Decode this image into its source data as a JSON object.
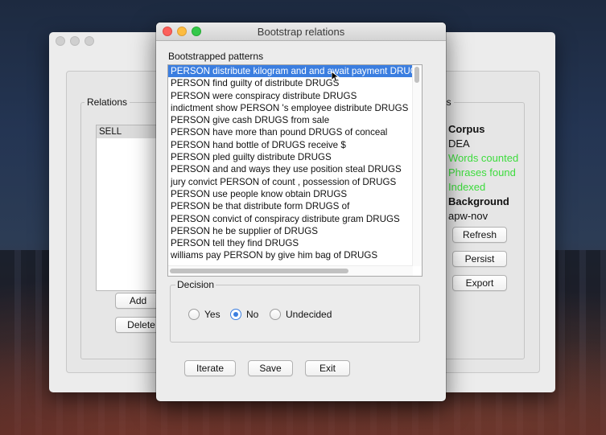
{
  "main_window": {
    "relations_title": "Relations",
    "relations_items": [
      "SELL"
    ],
    "add_label": "Add",
    "delete_label": "Delete",
    "status_title": "atus",
    "status": {
      "corpus_label": "Corpus",
      "corpus_value": "DEA",
      "words_counted": "Words counted",
      "phrases_found": "Phrases found",
      "indexed": "Indexed",
      "background_label": "Background",
      "background_value": "apw-nov"
    },
    "refresh_label": "Refresh",
    "persist_label": "Persist",
    "export_label": "Export",
    "colors": {
      "status_green": "#3ddc3d"
    }
  },
  "dialog": {
    "title": "Bootstrap relations",
    "patterns_label": "Bootstrapped patterns",
    "patterns": [
      "PERSON distribute kilogram and and await payment DRUGS",
      "PERSON find guilty of distribute DRUGS",
      "PERSON were conspiracy distribute DRUGS",
      "indictment show PERSON 's employee distribute DRUGS",
      "PERSON give cash DRUGS from sale",
      "PERSON have more than pound DRUGS of conceal",
      "PERSON hand bottle of DRUGS receive $",
      "PERSON pled guilty distribute DRUGS",
      "PERSON and and ways they use position steal DRUGS",
      "jury convict PERSON of count , possession of DRUGS",
      "PERSON use people know obtain DRUGS",
      "PERSON be that distribute form DRUGS of",
      "PERSON convict of conspiracy distribute gram DRUGS",
      "PERSON he be supplier of DRUGS",
      "PERSON tell they find DRUGS",
      "williams pay PERSON by give him bag of DRUGS"
    ],
    "selected_index": 0,
    "decision_label": "Decision",
    "options": {
      "yes": "Yes",
      "no": "No",
      "undecided": "Undecided"
    },
    "selected_option": "No",
    "iterate_label": "Iterate",
    "save_label": "Save",
    "exit_label": "Exit",
    "colors": {
      "selection": "#3b7ee0",
      "close": "#fc605b",
      "minimize": "#fdbc40",
      "zoom": "#34c84a"
    }
  }
}
